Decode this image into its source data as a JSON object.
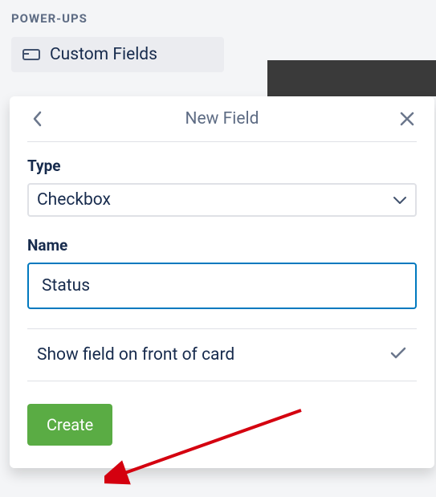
{
  "sidebar": {
    "sectionTitle": "POWER-UPS",
    "item": {
      "label": "Custom Fields"
    }
  },
  "popover": {
    "title": "New Field",
    "typeLabel": "Type",
    "typeValue": "Checkbox",
    "nameLabel": "Name",
    "nameValue": "Status",
    "showOnFront": "Show field on front of card",
    "createLabel": "Create"
  }
}
